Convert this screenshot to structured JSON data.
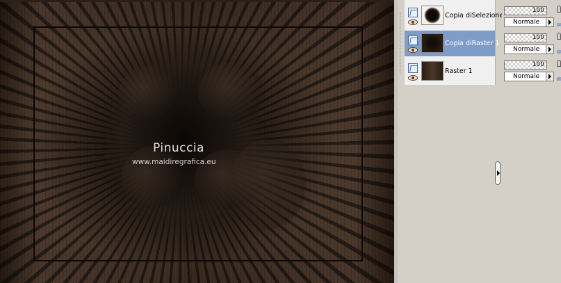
{
  "canvas": {
    "watermark_name": "Pinuccia",
    "watermark_url": "www.maidiregrafica.eu"
  },
  "layers": [
    {
      "name": "Copia diSelezione",
      "selected": false,
      "thumb_color": "#1a120c"
    },
    {
      "name": "Copia diRaster 1",
      "selected": true,
      "thumb_color": "#2a1d14"
    },
    {
      "name": "Raster 1",
      "selected": false,
      "thumb_color": "#3b2a1e"
    }
  ],
  "properties": [
    {
      "opacity": "100",
      "blend_mode": "Normale"
    },
    {
      "opacity": "100",
      "blend_mode": "Normale"
    },
    {
      "opacity": "100",
      "blend_mode": "Normale"
    }
  ],
  "colors": {
    "selected_row": "#7f9cc8",
    "panel_bg": "#d4d0c8"
  }
}
